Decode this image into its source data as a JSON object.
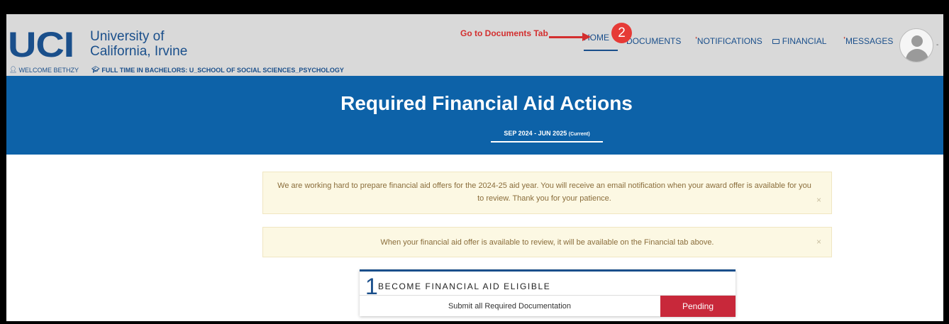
{
  "header": {
    "logo_mark": "UCI",
    "logo_line1": "University of",
    "logo_line2": "California, Irvine",
    "welcome": "WELCOME BETHZY",
    "program": "FULL TIME IN BACHELORS: U_SCHOOL OF SOCIAL SCIENCES_PSYCHOLOGY"
  },
  "nav": {
    "home": "HOME",
    "documents": "DOCUMENTS",
    "notifications": "NOTIFICATIONS",
    "financial": "FINANCIAL",
    "messages": "MESSAGES",
    "more": "-"
  },
  "annotation": {
    "label": "Go to Documents Tab",
    "step": "2"
  },
  "banner": {
    "title": "Required Financial Aid Actions",
    "tab_label": "SEP 2024 - JUN 2025",
    "tab_current": "(Current)"
  },
  "alerts": [
    {
      "text": "We are working hard to prepare financial aid offers for the 2024-25 aid year. You will receive an email notification when your award offer is available for you to review. Thank you for your patience.",
      "close": "×"
    },
    {
      "text": "When your financial aid offer is available to review, it will be available on the Financial tab above.",
      "close": "×"
    }
  ],
  "step": {
    "number": "1",
    "title": "BECOME FINANCIAL AID ELIGIBLE",
    "task": "Submit all Required Documentation",
    "status": "Pending"
  },
  "colors": {
    "brand_blue": "#1a4f8b",
    "banner_blue": "#0d62a8",
    "annotation_red": "#d32f2f",
    "pending_red": "#c8283a",
    "alert_bg": "#fcf8e3"
  },
  "icons": [
    "user-icon",
    "graduation-cap-icon",
    "card-icon",
    "avatar-icon",
    "close-icon"
  ]
}
